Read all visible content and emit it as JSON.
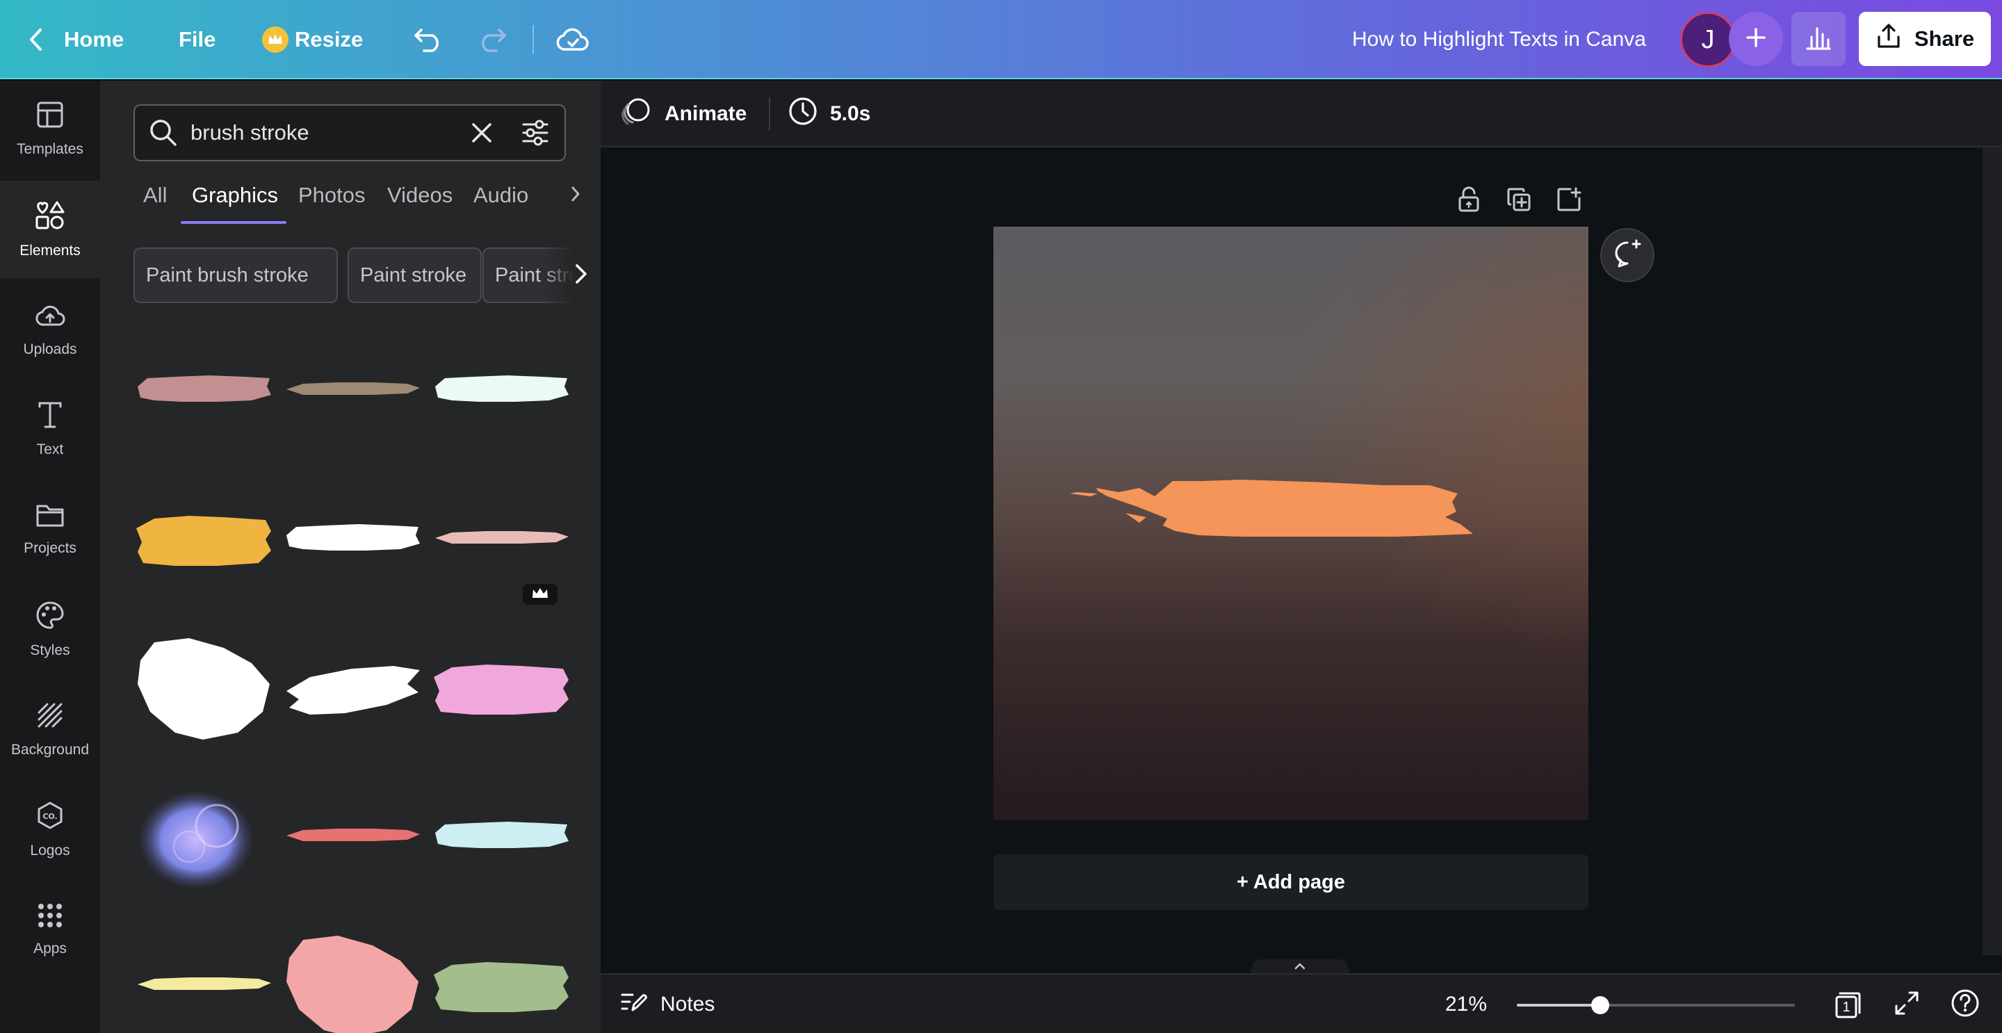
{
  "topbar": {
    "home_label": "Home",
    "file_label": "File",
    "resize_label": "Resize",
    "doc_title": "How to Highlight Texts in Canva",
    "avatar_initial": "J",
    "share_label": "Share",
    "gradient": [
      "#33b9c6",
      "#7a4ae0"
    ]
  },
  "rail": {
    "items": [
      {
        "label": "Templates",
        "icon": "templates-icon"
      },
      {
        "label": "Elements",
        "icon": "elements-icon"
      },
      {
        "label": "Uploads",
        "icon": "uploads-icon"
      },
      {
        "label": "Text",
        "icon": "text-icon"
      },
      {
        "label": "Projects",
        "icon": "projects-icon"
      },
      {
        "label": "Styles",
        "icon": "styles-icon"
      },
      {
        "label": "Background",
        "icon": "background-icon"
      },
      {
        "label": "Logos",
        "icon": "logos-icon"
      },
      {
        "label": "Apps",
        "icon": "apps-icon"
      }
    ],
    "active_index": 1
  },
  "panel": {
    "search_value": "brush stroke",
    "tabs": [
      "All",
      "Graphics",
      "Photos",
      "Videos",
      "Audio"
    ],
    "active_tab": "Graphics",
    "chips": [
      "Paint brush stroke",
      "Paint stroke",
      "Paint stroke"
    ],
    "grid": [
      {
        "type": "stroke",
        "color": "#c29090"
      },
      {
        "type": "stroke-thin",
        "color": "#9e8a73"
      },
      {
        "type": "stroke",
        "color": "#eafbf3"
      },
      {
        "type": "stroke-tall",
        "color": "#f0b440"
      },
      {
        "type": "stroke",
        "color": "#ffffff"
      },
      {
        "type": "stroke-thin",
        "color": "#e8bcb8",
        "premium": true
      },
      {
        "type": "scribble",
        "color": "#ffffff"
      },
      {
        "type": "swoosh",
        "color": "#ffffff"
      },
      {
        "type": "stroke-tall",
        "color": "#f0a8dc"
      },
      {
        "type": "smoke",
        "color": "#7d86e6"
      },
      {
        "type": "stroke-thin",
        "color": "#e87272"
      },
      {
        "type": "stroke",
        "color": "#cdeef3"
      },
      {
        "type": "stroke-thin",
        "color": "#f5eba0"
      },
      {
        "type": "scribble",
        "color": "#f4a6a6"
      },
      {
        "type": "stroke-tall",
        "color": "#a3be8c"
      }
    ]
  },
  "editor": {
    "animate_label": "Animate",
    "duration_label": "5.0s",
    "canvas_stroke_color": "#f5955a",
    "add_page_label": "+ Add page"
  },
  "footer": {
    "notes_label": "Notes",
    "zoom_label": "21%",
    "zoom_fraction": 0.21,
    "page_count": "1"
  }
}
